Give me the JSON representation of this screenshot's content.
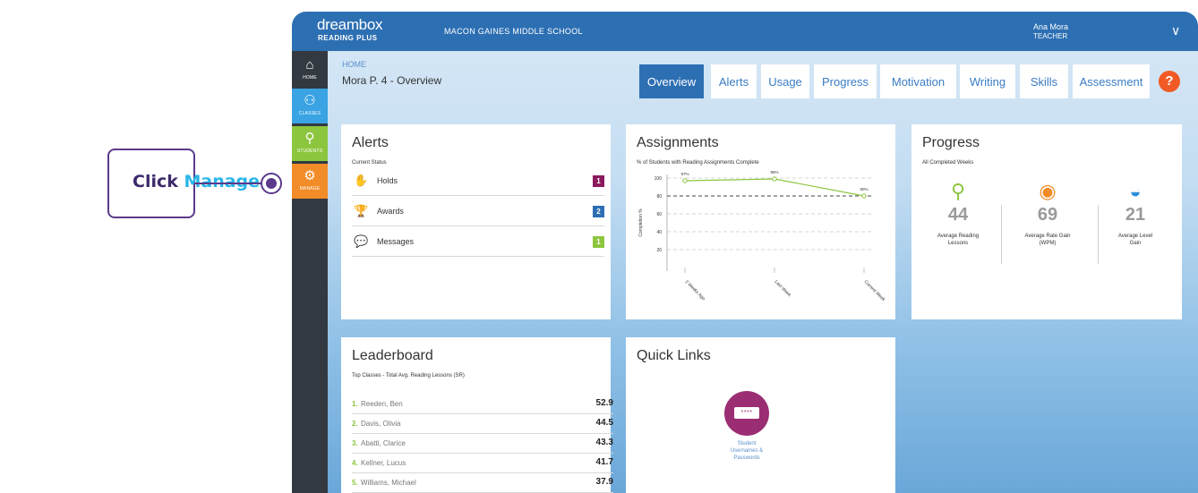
{
  "callout": {
    "prefix": "Click ",
    "highlight": "Manage"
  },
  "header": {
    "logo_line1": "dreambox",
    "logo_line2": "READING PLUS",
    "school": "MACON GAINES MIDDLE SCHOOL",
    "user_name": "Ana Mora",
    "user_role": "TEACHER",
    "menu_chevron": "∨"
  },
  "sidebar": {
    "items": [
      {
        "label": "HOME",
        "icon": "home-icon",
        "glyph": "⌂"
      },
      {
        "label": "CLASSES",
        "icon": "classes-icon",
        "glyph": "⚇"
      },
      {
        "label": "STUDENTS",
        "icon": "student-icon",
        "glyph": "⚲"
      },
      {
        "label": "MANAGE",
        "icon": "gear-icon",
        "glyph": "⚙"
      }
    ]
  },
  "breadcrumb": "HOME",
  "page_title": "Mora P. 4 - Overview",
  "tabs": [
    {
      "label": "Overview"
    },
    {
      "label": "Alerts"
    },
    {
      "label": "Usage"
    },
    {
      "label": "Progress"
    },
    {
      "label": "Motivation"
    },
    {
      "label": "Writing"
    },
    {
      "label": "Skills"
    },
    {
      "label": "Assessment"
    }
  ],
  "help_label": "?",
  "alerts": {
    "title": "Alerts",
    "subtitle": "Current Status",
    "rows": [
      {
        "label": "Holds",
        "count": "1",
        "color": "#8b1a5c",
        "icon_color": "#8b1a5c",
        "glyph": "✋"
      },
      {
        "label": "Awards",
        "count": "2",
        "color": "#2d6fb3",
        "icon_color": "#2d6fb3",
        "glyph": "🏆"
      },
      {
        "label": "Messages",
        "count": "1",
        "color": "#8cc63f",
        "icon_color": "#8cc63f",
        "glyph": "💬"
      }
    ]
  },
  "assignments": {
    "title": "Assignments",
    "subtitle": "% of Students with Reading Assignments Complete"
  },
  "chart_data": {
    "type": "line",
    "title": "Assignments",
    "subtitle": "% of Students with Reading Assignments Complete",
    "ylabel": "Completion %",
    "categories": [
      "2 Weeks Ago",
      "Last Week",
      "Current Week"
    ],
    "values": [
      97,
      99,
      80
    ],
    "data_labels": [
      "97%",
      "96%",
      "80%"
    ],
    "yticks": [
      20,
      40,
      60,
      80,
      100
    ],
    "ylim": [
      0,
      100
    ]
  },
  "progress": {
    "title": "Progress",
    "subtitle": "All Completed Weeks",
    "cols": [
      {
        "value": "44",
        "label_1": "Average Reading",
        "label_2": "Lessons",
        "color": "#8cc63f",
        "glyph": "⚲"
      },
      {
        "value": "69",
        "label_1": "Average Rate Gain",
        "label_2": "(WPM)",
        "color": "#f28c28",
        "glyph": "◉"
      },
      {
        "value": "21",
        "label_1": "Average Level",
        "label_2": "Gain",
        "color": "#2d8fd6",
        "glyph": "◒"
      }
    ]
  },
  "leaderboard": {
    "title": "Leaderboard",
    "subtitle": "Top Classes - Total Avg. Reading Lessons (SR)",
    "rows": [
      {
        "rank": "1.",
        "name": "Reeden, Ben",
        "value": "52.9"
      },
      {
        "rank": "2.",
        "name": "Davis, Olivia",
        "value": "44.5"
      },
      {
        "rank": "3.",
        "name": "Abatti, Clarice",
        "value": "43.3"
      },
      {
        "rank": "4.",
        "name": "Kellner, Lucus",
        "value": "41.7"
      },
      {
        "rank": "5.",
        "name": "Williams, Michael",
        "value": "37.9"
      }
    ]
  },
  "quick_links": {
    "title": "Quick Links",
    "password_glyph": "****",
    "link_line1": "Student",
    "link_line2": "Usernames &",
    "link_line3": "Passwords"
  }
}
